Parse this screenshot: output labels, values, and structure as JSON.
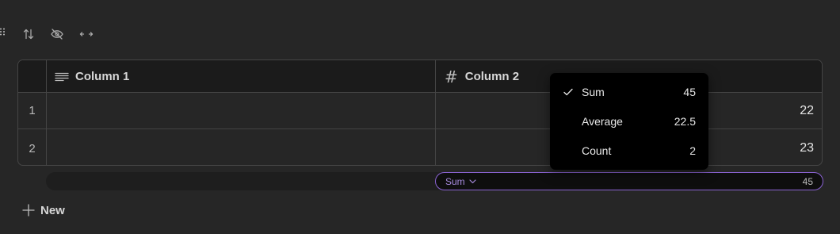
{
  "colors": {
    "background": "#262626",
    "header_background": "#1b1b1b",
    "border": "#454545",
    "accent": "#8a63d2",
    "accent_text": "#a78bde",
    "menu_background": "#000000"
  },
  "toolbar": {
    "icons": [
      "drag-handle-icon",
      "sort-icon",
      "hide-icon",
      "resize-width-icon"
    ]
  },
  "table": {
    "columns": [
      {
        "label": "Column 1",
        "icon": "text-lines-icon"
      },
      {
        "label": "Column 2",
        "icon": "number-hash-icon",
        "icon_glyph": "#"
      }
    ],
    "rows": [
      {
        "number": "1",
        "column2": "22"
      },
      {
        "number": "2",
        "column2": "23"
      }
    ]
  },
  "footer": {
    "aggregate_label": "Sum",
    "aggregate_value": "45"
  },
  "new_button": {
    "label": "New"
  },
  "aggregate_menu": {
    "selected": "Sum",
    "items": [
      {
        "label": "Sum",
        "value": "45",
        "checked": true
      },
      {
        "label": "Average",
        "value": "22.5",
        "checked": false
      },
      {
        "label": "Count",
        "value": "2",
        "checked": false
      }
    ]
  }
}
